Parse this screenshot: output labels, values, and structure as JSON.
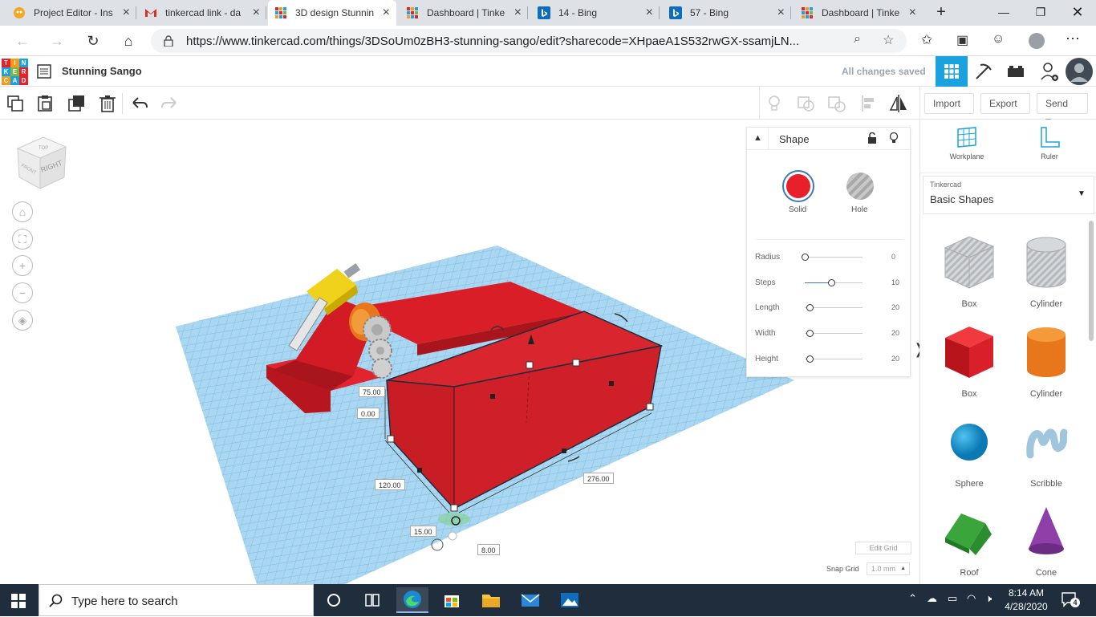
{
  "browser": {
    "tabs": [
      {
        "label": "Project Editor - Ins",
        "icon": "scratch-icon"
      },
      {
        "label": "tinkercad link - da",
        "icon": "gmail-icon"
      },
      {
        "label": "3D design Stunnin",
        "icon": "tinkercad-icon",
        "active": true
      },
      {
        "label": "Dashboard | Tinke",
        "icon": "tinkercad-icon"
      },
      {
        "label": "14 - Bing",
        "icon": "bing-icon"
      },
      {
        "label": "57 - Bing",
        "icon": "bing-icon"
      },
      {
        "label": "Dashboard | Tinke",
        "icon": "tinkercad-icon"
      }
    ],
    "url": "https://www.tinkercad.com/things/3DSoUm0zBH3-stunning-sango/edit?sharecode=XHpaeA1S532rwGX-ssamjLN..."
  },
  "app": {
    "logo_letters": [
      "T",
      "I",
      "N",
      "K",
      "E",
      "R",
      "C",
      "A",
      "D"
    ],
    "title": "Stunning Sango",
    "save_status": "All changes saved"
  },
  "toolbar": {
    "import": "Import",
    "export": "Export",
    "send_to": "Send To"
  },
  "viewcube": {
    "top": "TOP",
    "front": "FRONT",
    "right": "RIGHT"
  },
  "inspector": {
    "title": "Shape",
    "solid": "Solid",
    "hole": "Hole",
    "solid_color": "#e8202b",
    "params": [
      {
        "label": "Radius",
        "value": "0",
        "level": 0
      },
      {
        "label": "Steps",
        "value": "10",
        "level": 0.45
      },
      {
        "label": "Length",
        "value": "20",
        "level": 0.05
      },
      {
        "label": "Width",
        "value": "20",
        "level": 0.05
      },
      {
        "label": "Height",
        "value": "20",
        "level": 0.05
      }
    ]
  },
  "dimensions": {
    "height": "75.00",
    "elevation": "0.00",
    "width": "120.00",
    "length": "276.00",
    "offset_y": "15.00",
    "offset_x": "8.00"
  },
  "sidepanel": {
    "workplane": "Workplane",
    "ruler": "Ruler",
    "category_source": "Tinkercad",
    "category": "Basic Shapes",
    "shapes": [
      {
        "label": "Box",
        "kind": "box-hole"
      },
      {
        "label": "Cylinder",
        "kind": "cylinder-hole"
      },
      {
        "label": "Box",
        "kind": "box-red"
      },
      {
        "label": "Cylinder",
        "kind": "cylinder-orange"
      },
      {
        "label": "Sphere",
        "kind": "sphere-blue"
      },
      {
        "label": "Scribble",
        "kind": "scribble"
      },
      {
        "label": "Roof",
        "kind": "roof-green"
      },
      {
        "label": "Cone",
        "kind": "cone-purple"
      }
    ]
  },
  "grid": {
    "edit_grid": "Edit Grid",
    "snap_grid_label": "Snap Grid",
    "snap_grid_value": "1.0 mm"
  },
  "taskbar": {
    "search_placeholder": "Type here to search",
    "time": "8:14 AM",
    "date": "4/28/2020",
    "notifications": "4"
  }
}
